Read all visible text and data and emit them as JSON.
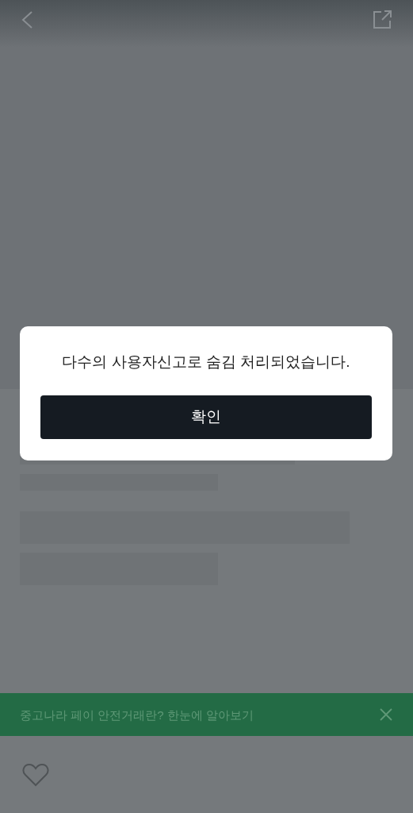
{
  "banner": {
    "text": "중고나라 페이 안전거래란? 한눈에 알아보기"
  },
  "bottom_bar": {
    "liked": false
  },
  "dialog": {
    "message": "다수의 사용자신고로 숨김 처리되었습니다.",
    "button": "확인"
  }
}
